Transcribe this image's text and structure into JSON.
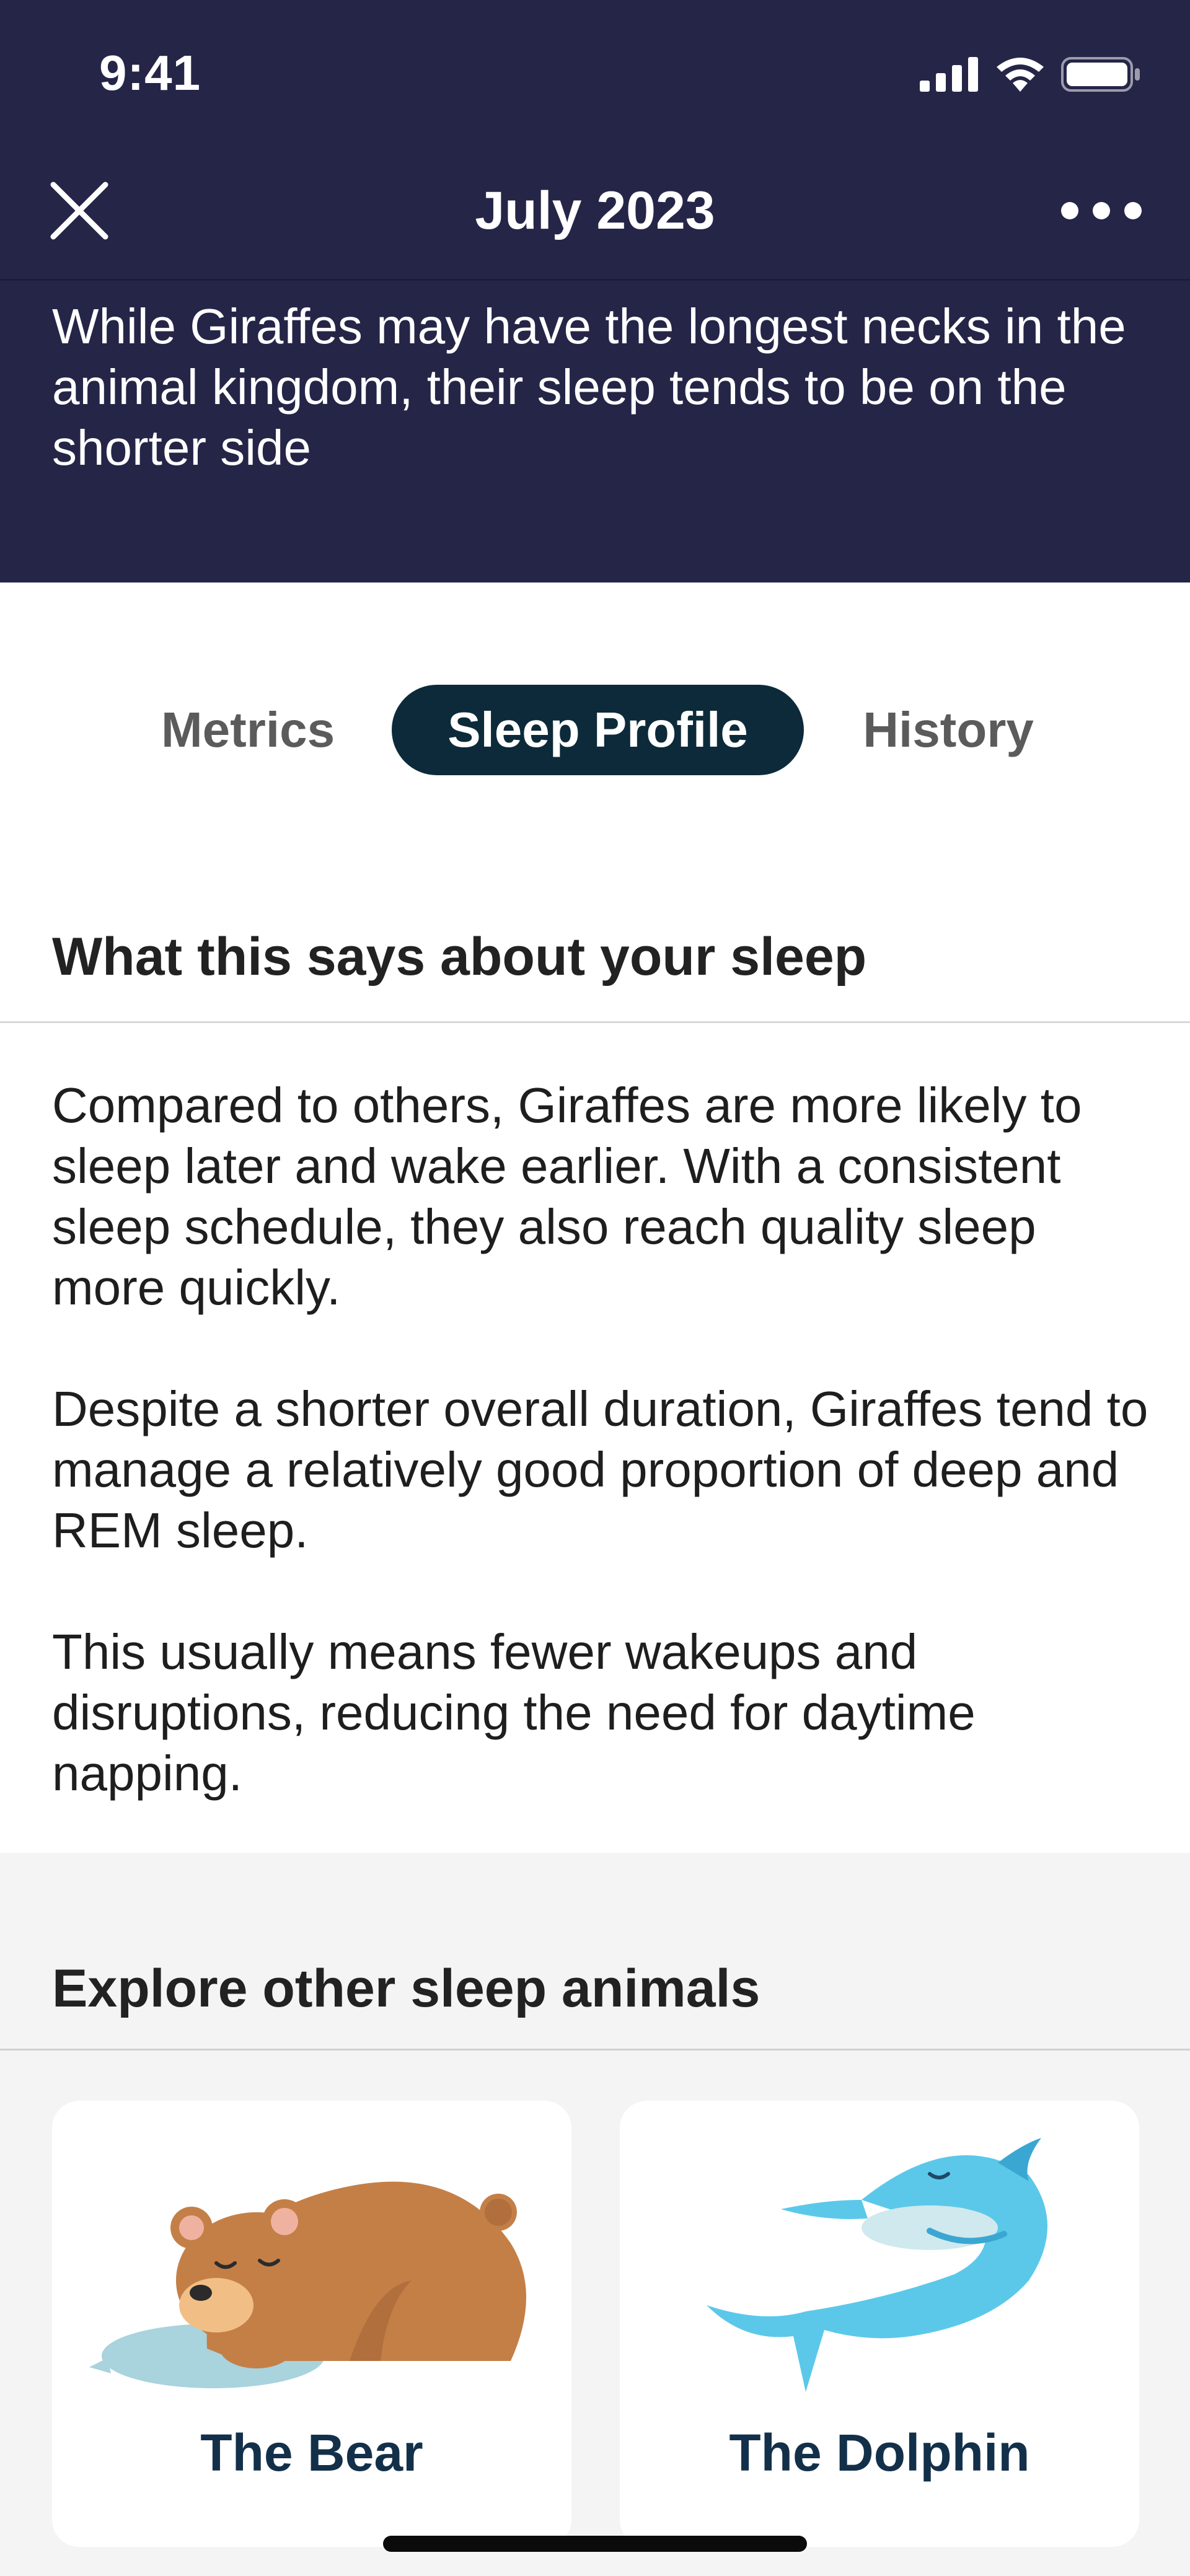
{
  "status_bar": {
    "time": "9:41"
  },
  "nav": {
    "title": "July 2023",
    "close_icon": "close-icon",
    "more_icon": "more-icon"
  },
  "header_description": "While Giraffes may have the longest necks in the animal kingdom, their sleep tends to be on the shorter side",
  "tabs": [
    {
      "label": "Metrics",
      "selected": false
    },
    {
      "label": "Sleep Profile",
      "selected": true
    },
    {
      "label": "History",
      "selected": false
    }
  ],
  "sleep_section": {
    "heading": "What this says about your sleep",
    "paragraphs": [
      "Compared to others, Giraffes are more likely to sleep later and wake earlier. With a consistent sleep schedule, they also reach quality sleep more quickly.",
      "Despite a shorter overall duration, Giraffes tend to manage a relatively good proportion of deep and REM sleep.",
      "This usually means fewer wakeups and disruptions, reducing the need for daytime napping."
    ]
  },
  "explore": {
    "heading": "Explore other sleep animals",
    "animals": [
      {
        "name": "The Bear",
        "icon": "bear-illustration"
      },
      {
        "name": "The Dolphin",
        "icon": "dolphin-illustration"
      }
    ]
  },
  "colors": {
    "header_bg": "#252548",
    "tab_selected_bg": "#0c2a3a",
    "explore_bg": "#f4f4f4",
    "card_title": "#13304a"
  }
}
